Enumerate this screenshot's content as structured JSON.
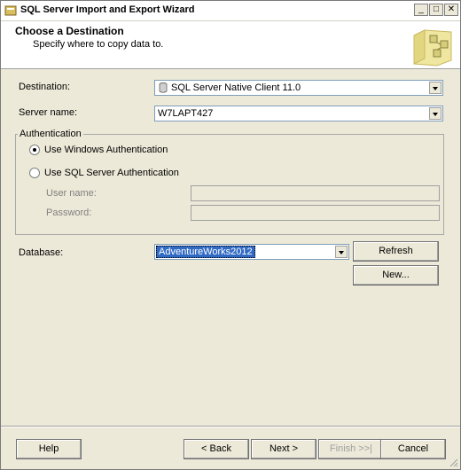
{
  "window": {
    "title": "SQL Server Import and Export Wizard",
    "min_glyph": "_",
    "max_glyph": "□",
    "close_glyph": "✕"
  },
  "header": {
    "title": "Choose a Destination",
    "subtitle": "Specify where to copy data to."
  },
  "form": {
    "destination_label": "Destination:",
    "destination_value": "SQL Server Native Client 11.0",
    "server_label": "Server name:",
    "server_value": "W7LAPT427",
    "auth_group_label": "Authentication",
    "windows_auth_label": "Use Windows Authentication",
    "sql_auth_label": "Use SQL Server Authentication",
    "username_label": "User name:",
    "password_label": "Password:",
    "database_label": "Database:",
    "database_value": "AdventureWorks2012",
    "refresh_label": "Refresh",
    "new_label": "New...",
    "selected_auth": "windows"
  },
  "footer": {
    "help_label": "Help",
    "back_label": "< Back",
    "next_label": "Next >",
    "finish_label": "Finish >>|",
    "cancel_label": "Cancel"
  },
  "colors": {
    "selection": "#316ac5",
    "face": "#ece9d8"
  }
}
